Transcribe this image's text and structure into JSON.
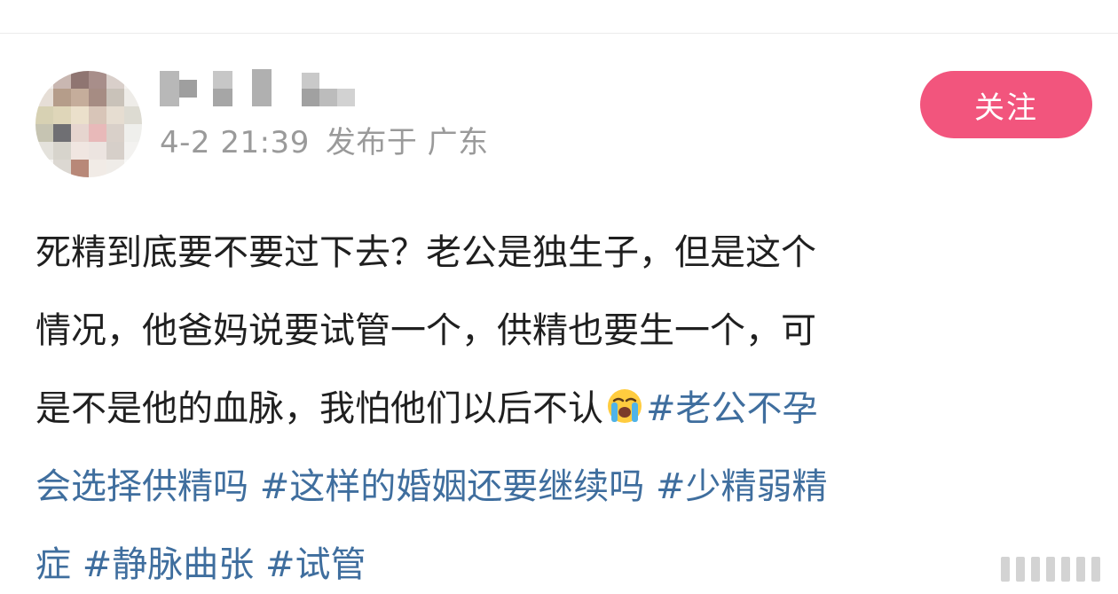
{
  "post": {
    "timestamp": "4-2 21:39",
    "location": "发布于 广东",
    "follow_label": "关注",
    "content_line1": "死精到底要不要过下去？老公是独生子，但是这个",
    "content_line2": "情况，他爸妈说要试管一个，供精也要生一个，可",
    "content_line3_text": "是不是他的血脉，我怕他们以后不认",
    "content_line3_emoji": "crying-face-emoji",
    "hashtag1_part1": "#老公不孕",
    "hashtag1_part2": "会选择供精吗",
    "hashtag2": "#这样的婚姻还要继续吗",
    "hashtag3_part1": "#少精弱精",
    "hashtag3_part2": "症",
    "hashtag4": "#静脉曲张",
    "hashtag5": "#试管"
  },
  "colors": {
    "accent": "#f2557d",
    "hashtag": "#3f6e9e",
    "meta": "#9a9a9a",
    "text": "#1f1f1f"
  }
}
